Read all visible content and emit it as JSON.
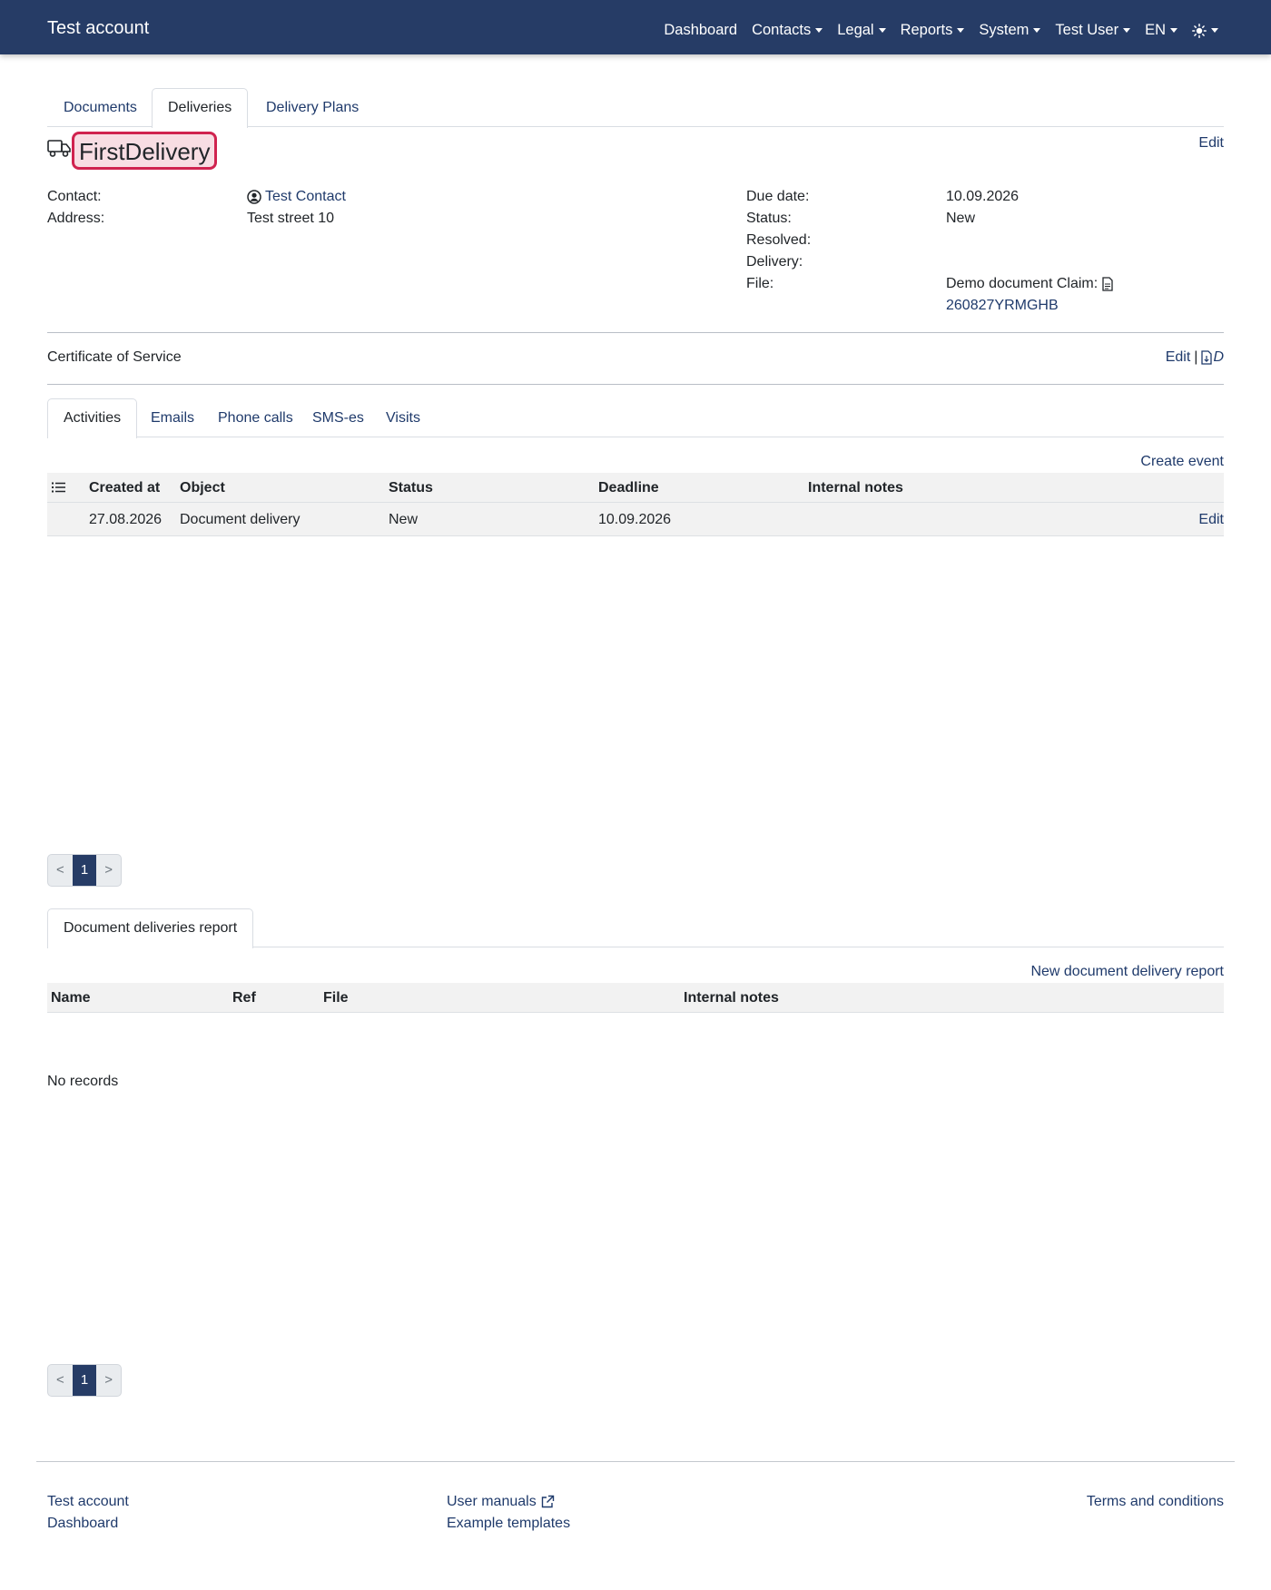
{
  "navbar": {
    "brand": "Test account",
    "items": [
      "Dashboard",
      "Contacts",
      "Legal",
      "Reports",
      "System",
      "Test User",
      "EN"
    ],
    "theme_icon": "sun-icon"
  },
  "main_tabs": [
    "Documents",
    "Deliveries",
    "Delivery Plans"
  ],
  "delivery": {
    "title": "FirstDelivery",
    "edit": "Edit",
    "left": {
      "contact_label": "Contact:",
      "contact_value": "Test Contact",
      "address_label": "Address:",
      "address_value": "Test street 10"
    },
    "right": {
      "due_label": "Due date:",
      "due_value": "10.09.2026",
      "status_label": "Status:",
      "status_value": "New",
      "resolved_label": "Resolved:",
      "delivery_label": "Delivery:",
      "file_label": "File:",
      "file_value": "Demo document Claim:",
      "file_link": "260827YRMGHB"
    }
  },
  "certificate": {
    "label": "Certificate of Service",
    "edit": "Edit",
    "separator": "|",
    "doc_letter": "D"
  },
  "activity_tabs": [
    "Activities",
    "Emails",
    "Phone calls",
    "SMS-es",
    "Visits"
  ],
  "activities": {
    "create": "Create event",
    "columns": [
      "Created at",
      "Object",
      "Status",
      "Deadline",
      "Internal notes"
    ],
    "rows": [
      {
        "created": "27.08.2026",
        "object": "Document delivery",
        "status": "New",
        "deadline": "10.09.2026",
        "notes": "",
        "action": "Edit"
      }
    ]
  },
  "pager": {
    "prev": "<",
    "page": "1",
    "next": ">"
  },
  "reports_tab": "Document deliveries report",
  "reports": {
    "create": "New document delivery report",
    "columns": [
      "Name",
      "Ref",
      "File",
      "Internal notes"
    ],
    "empty": "No records"
  },
  "footer": {
    "col1": [
      "Test account",
      "Dashboard"
    ],
    "col2": [
      "User manuals",
      "Example templates"
    ],
    "col3": [
      "Terms and conditions"
    ]
  }
}
